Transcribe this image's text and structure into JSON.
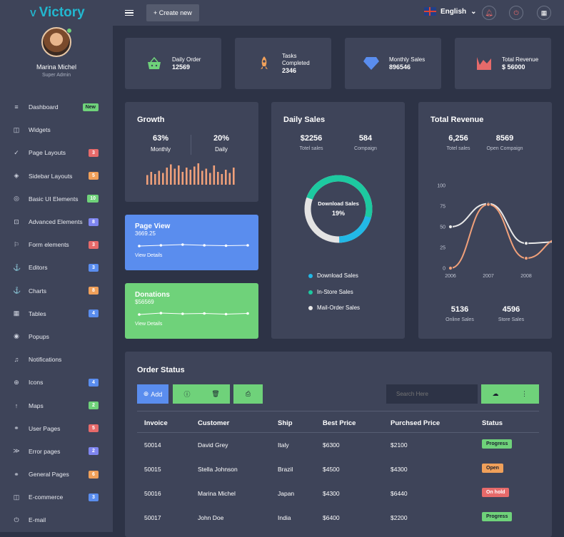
{
  "brand": {
    "name": "Victory"
  },
  "topbar": {
    "create_label": "+ Create new",
    "language": "English"
  },
  "profile": {
    "name": "Marina Michel",
    "role": "Super Admin"
  },
  "nav": [
    {
      "label": "Dashboard",
      "badge": "New",
      "icon": "≡",
      "color": "#6fd27a"
    },
    {
      "label": "Widgets",
      "badge": "",
      "icon": "◫",
      "color": ""
    },
    {
      "label": "Page Layouts",
      "badge": "3",
      "icon": "✓",
      "color": "#e66a6a"
    },
    {
      "label": "Sidebar Layouts",
      "badge": "5",
      "icon": "◈",
      "color": "#f0a05a"
    },
    {
      "label": "Basic UI Elements",
      "badge": "10",
      "icon": "◎",
      "color": "#6fd27a"
    },
    {
      "label": "Advanced Elements",
      "badge": "8",
      "icon": "⊡",
      "color": "#7f86f0"
    },
    {
      "label": "Form elements",
      "badge": "3",
      "icon": "⚐",
      "color": "#e66a6a"
    },
    {
      "label": "Editors",
      "badge": "3",
      "icon": "⚓",
      "color": "#5a8dee"
    },
    {
      "label": "Charts",
      "badge": "8",
      "icon": "⚓",
      "color": "#f0a05a"
    },
    {
      "label": "Tables",
      "badge": "4",
      "icon": "▦",
      "color": "#5a8dee"
    },
    {
      "label": "Popups",
      "badge": "",
      "icon": "◉",
      "color": ""
    },
    {
      "label": "Notifications",
      "badge": "",
      "icon": "♫",
      "color": ""
    },
    {
      "label": "Icons",
      "badge": "4",
      "icon": "⊕",
      "color": "#5a8dee"
    },
    {
      "label": "Maps",
      "badge": "2",
      "icon": "↑",
      "color": "#6fd27a"
    },
    {
      "label": "User Pages",
      "badge": "5",
      "icon": "⚭",
      "color": "#e66a6a"
    },
    {
      "label": "Error pages",
      "badge": "2",
      "icon": "≫",
      "color": "#7f86f0"
    },
    {
      "label": "General Pages",
      "badge": "6",
      "icon": "⚭",
      "color": "#f0a05a"
    },
    {
      "label": "E-commerce",
      "badge": "3",
      "icon": "◫",
      "color": "#5a8dee"
    },
    {
      "label": "E-mail",
      "badge": "",
      "icon": "⏻",
      "color": ""
    }
  ],
  "stats": [
    {
      "label": "Daily Order",
      "value": "12569",
      "icon": "basket"
    },
    {
      "label": "Tasks Completed",
      "value": "2346",
      "icon": "rocket"
    },
    {
      "label": "Monthly Sales",
      "value": "896546",
      "icon": "diamond"
    },
    {
      "label": "Total Revenue",
      "value": "$ 56000",
      "icon": "chart"
    }
  ],
  "growth": {
    "title": "Growth",
    "monthly_value": "63%",
    "monthly_label": "Monthly",
    "daily_value": "20%",
    "daily_label": "Daily",
    "bars": [
      0.45,
      0.6,
      0.5,
      0.65,
      0.55,
      0.8,
      0.95,
      0.75,
      0.9,
      0.6,
      0.8,
      0.7,
      0.85,
      1,
      0.65,
      0.75,
      0.55,
      0.9,
      0.6,
      0.5,
      0.7,
      0.55,
      0.8
    ]
  },
  "page_view": {
    "title": "Page View",
    "value": "3669.25",
    "link": "View Details",
    "points": [
      0.4,
      0.5,
      0.6,
      0.5,
      0.45,
      0.5
    ]
  },
  "donations": {
    "title": "Donations",
    "value": "$56569",
    "link": "View Details",
    "points": [
      0.4,
      0.6,
      0.5,
      0.55,
      0.45,
      0.55
    ]
  },
  "daily_sales": {
    "title": "Daily Sales",
    "total_value": "$2256",
    "total_label": "Totel sales",
    "campaign_value": "584",
    "campaign_label": "Compaign",
    "center_title": "Download Sales",
    "center_value": "19%",
    "legend": [
      {
        "label": "Download Sales",
        "color": "#22b8e6"
      },
      {
        "label": "In-Store Sales",
        "color": "#1dc9a0"
      },
      {
        "label": "Mail-Order Sales",
        "color": "#e8e8e8"
      }
    ]
  },
  "total_revenue": {
    "title": "Total Revenue",
    "total_value": "6,256",
    "total_label": "Totel sales",
    "open_value": "8569",
    "open_label": "Open Compaign",
    "online_value": "5136",
    "online_label": "Online Sales",
    "store_value": "4596",
    "store_label": "Store Sales"
  },
  "chart_data": {
    "type": "line",
    "x": [
      "2006",
      "2007",
      "2008"
    ],
    "ylim": [
      0,
      100
    ],
    "yticks": [
      0,
      25,
      50,
      75,
      100
    ],
    "series": [
      {
        "values": [
          50,
          78,
          30,
          32
        ],
        "color": "#e8e8e8"
      },
      {
        "values": [
          0,
          77,
          12,
          36
        ],
        "color": "#f0a07a"
      }
    ]
  },
  "orders": {
    "title": "Order Status",
    "add_label": "Add",
    "search_placeholder": "Search Here",
    "columns": [
      "Invoice",
      "Customer",
      "Ship",
      "Best Price",
      "Purchsed Price",
      "Status"
    ],
    "rows": [
      {
        "invoice": "50014",
        "customer": "David Grey",
        "ship": "Italy",
        "best": "$6300",
        "purchased": "$2100",
        "status": "Progress",
        "color": "#6fd27a"
      },
      {
        "invoice": "50015",
        "customer": "Stella Johnson",
        "ship": "Brazil",
        "best": "$4500",
        "purchased": "$4300",
        "status": "Open",
        "color": "#f0a05a"
      },
      {
        "invoice": "50016",
        "customer": "Marina Michel",
        "ship": "Japan",
        "best": "$4300",
        "purchased": "$6440",
        "status": "On hold",
        "color": "#e66a6a"
      },
      {
        "invoice": "50017",
        "customer": "John Doe",
        "ship": "India",
        "best": "$6400",
        "purchased": "$2200",
        "status": "Progress",
        "color": "#6fd27a"
      }
    ]
  }
}
